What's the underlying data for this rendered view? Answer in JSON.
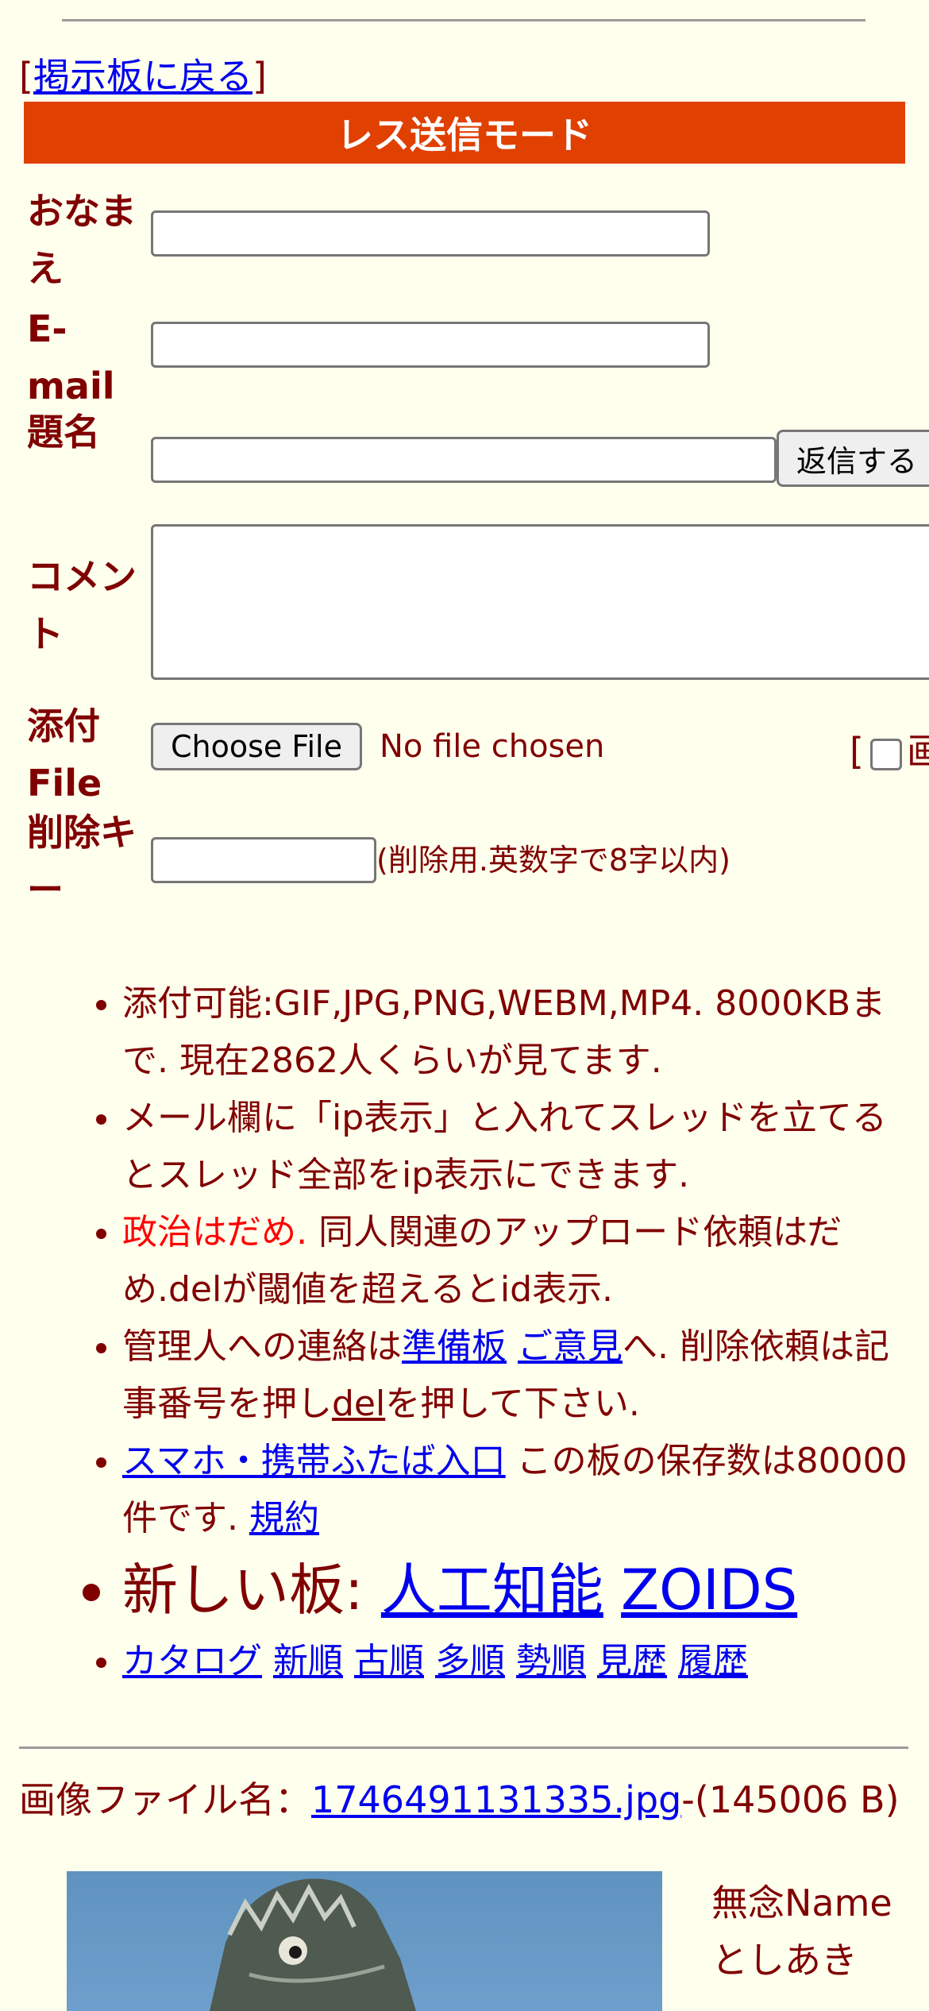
{
  "nav": {
    "open_bracket": "[",
    "back_link": "掲示板に戻る",
    "close_bracket": "]"
  },
  "form": {
    "title": "レス送信モード",
    "name_label": "おなまえ",
    "email_label": "E-mail",
    "subject_label": "題名",
    "comment_label": "コメント",
    "file_label": "添付File",
    "delkey_label": "削除キー",
    "submit_label": "返信する",
    "choose_file_label": "Choose File",
    "no_file_text": "No file chosen",
    "bracket_text": "[",
    "bracket_text_cut": "画",
    "delkey_note": "(削除用.英数字で8字以内)"
  },
  "notes": {
    "n1": "添付可能:GIF,JPG,PNG,WEBM,MP4. 8000KBまで. 現在2862人くらいが見てます.",
    "n2": "メール欄に「ip表示」と入れてスレッドを立てるとスレッド全部をip表示にできます.",
    "n3_red": "政治はだめ.",
    "n3_rest": " 同人関連のアップロード依頼はだめ.delが閾値を超えるとid表示.",
    "n4_a": "管理人への連絡は",
    "n4_link1": "準備板",
    "n4_link2": "ご意見",
    "n4_b": "へ. 削除依頼は記事番号を押し",
    "n4_link3": "del",
    "n4_c": "を押して下さい.",
    "n5_link1": "スマホ・携帯ふたば入口",
    "n5_a": " この板の保存数は80000件です. ",
    "n5_link2": "規約",
    "n6_label": "新しい板: ",
    "n6_link1": "人工知能",
    "n6_link2": "ZOIDS",
    "n7_links": [
      "カタログ",
      "新順",
      "古順",
      "多順",
      "勢順",
      "見歴",
      "履歴"
    ]
  },
  "post": {
    "file_label": "画像ファイル名：",
    "file_link": "1746491131335.jpg",
    "file_size": "-(145006 B)",
    "name_line1": "無念Name",
    "name_line2": "としあき"
  }
}
